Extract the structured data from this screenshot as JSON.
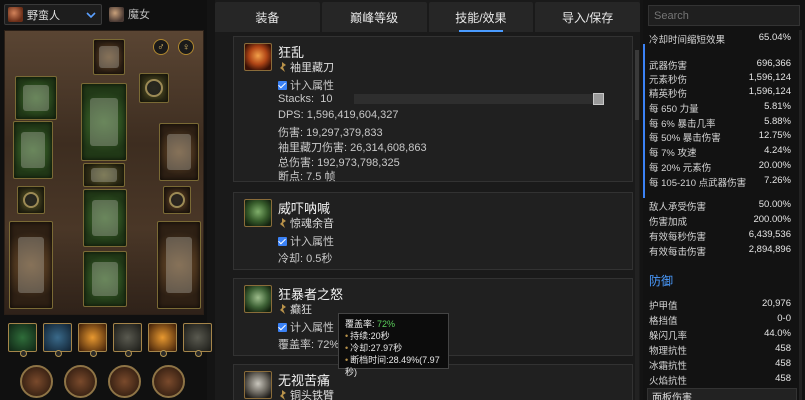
{
  "left": {
    "class_select": "野蛮人",
    "alt_class": "魔女",
    "gender_male": "♂",
    "gender_female": "♀"
  },
  "tabs": [
    "装备",
    "巅峰等级",
    "技能/效果",
    "导入/保存"
  ],
  "skills": [
    {
      "bullet": "",
      "name": "狂乱",
      "rune": "袖里藏刀",
      "include_label": "计入属性",
      "stacks_label": "Stacks:",
      "stacks_value": "10",
      "lines": [
        "DPS: 1,596,419,604,327",
        "伤害: 19,297,379,833",
        "袖里藏刀伤害: 26,314,608,863",
        "总伤害: 192,973,798,325",
        "断点: 7.5 帧"
      ]
    },
    {
      "bullet": "",
      "name": "威吓呐喊",
      "rune": "惊魂余音",
      "include_label": "计入属性",
      "lines": [
        "冷却: 0.5秒"
      ]
    },
    {
      "bullet": "1",
      "name": "狂暴者之怒",
      "rune": "癫狂",
      "include_label": "计入属性",
      "lines": [
        "覆盖率: 72%"
      ]
    },
    {
      "bullet": "2",
      "name": "无视苦痛",
      "rune": "铜头铁臂"
    }
  ],
  "tooltip": {
    "coverage_label": "覆盖率:",
    "coverage_value": "72%",
    "duration": "持续:20秒",
    "cooldown": "冷却:27.97秒",
    "gap": "断档时间:28.49%(7.97秒)"
  },
  "right": {
    "search_placeholder": "Search",
    "stats": [
      {
        "label": "冷却时间缩短效果",
        "value": "65.04%"
      },
      {
        "label": "武器伤害",
        "value": "696,366"
      },
      {
        "label": "元素秒伤",
        "value": "1,596,124"
      },
      {
        "label": "精英秒伤",
        "value": "1,596,124"
      },
      {
        "label": "每 650 力量",
        "value": "5.81%"
      },
      {
        "label": "每 6% 暴击几率",
        "value": "5.88%"
      },
      {
        "label": "每 50% 暴击伤害",
        "value": "12.75%"
      },
      {
        "label": "每 7% 攻速",
        "value": "4.24%"
      },
      {
        "label": "每 20% 元素伤",
        "value": "20.00%"
      },
      {
        "label": "每 105-210 点武器伤害",
        "value": "7.26%"
      },
      {
        "label": "敌人承受伤害",
        "value": "50.00%"
      },
      {
        "label": "伤害加成",
        "value": "200.00%"
      },
      {
        "label": "有效每秒伤害",
        "value": "6,439,536"
      },
      {
        "label": "有效每击伤害",
        "value": "2,894,896"
      }
    ],
    "defense_title": "防御",
    "defense": [
      {
        "label": "护甲值",
        "value": "20,976"
      },
      {
        "label": "格挡值",
        "value": "0-0"
      },
      {
        "label": "躲闪几率",
        "value": "44.0%"
      },
      {
        "label": "物理抗性",
        "value": "458"
      },
      {
        "label": "冰霜抗性",
        "value": "458"
      },
      {
        "label": "火焰抗性",
        "value": "458"
      }
    ],
    "bottom_tab": "面板伤害"
  }
}
